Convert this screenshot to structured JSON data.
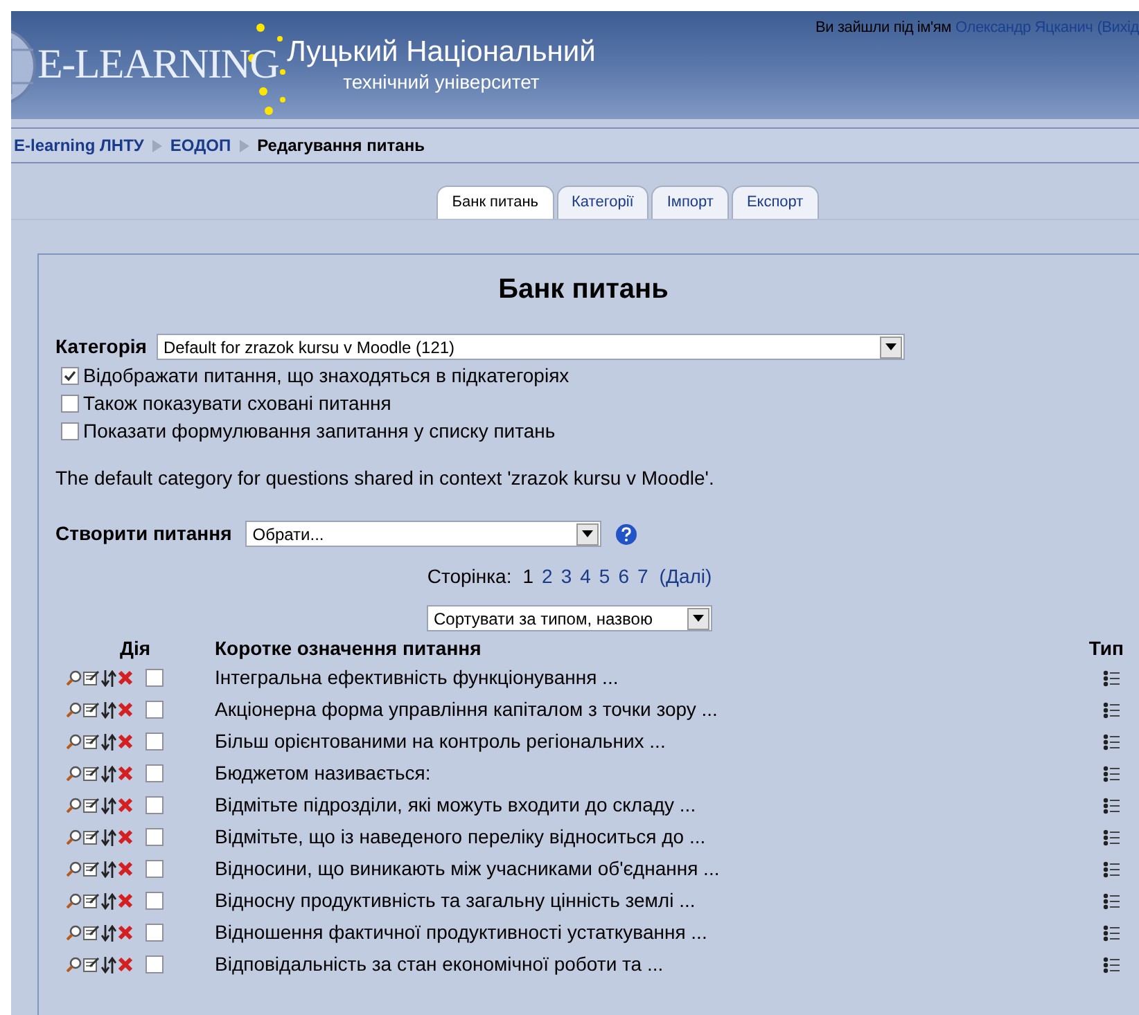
{
  "header": {
    "logo_text": "E-LEARNING",
    "institution_line1": "Луцький Національний",
    "institution_line2": "технічний університет",
    "login_prefix": "Ви зайшли під ім'ям",
    "user_link": "Олександр Яцканич",
    "logout": "(Вихід"
  },
  "breadcrumb": [
    {
      "label": "E-learning ЛНТУ",
      "kind": "link"
    },
    {
      "label": "ЕОДОП",
      "kind": "link"
    },
    {
      "label": "Редагування питань",
      "kind": "current"
    }
  ],
  "tabs": [
    {
      "label": "Банк питань",
      "selected": true
    },
    {
      "label": "Категорії",
      "selected": false
    },
    {
      "label": "Імпорт",
      "selected": false
    },
    {
      "label": "Експорт",
      "selected": false
    }
  ],
  "heading": "Банк питань",
  "category": {
    "label": "Категорія",
    "value": "Default for zrazok kursu v Moodle (121)"
  },
  "options": [
    {
      "label": "Відображати питання, що знаходяться в підкатегоріях",
      "checked": true
    },
    {
      "label": "Також показувати сховані питання",
      "checked": false
    },
    {
      "label": "Показати формулювання запитання у списку питань",
      "checked": false
    }
  ],
  "info": "The default category for questions shared in context 'zrazok kursu v Moodle'.",
  "create": {
    "label": "Створити питання",
    "value": "Обрати..."
  },
  "pagination": {
    "label": "Сторінка:",
    "pages": [
      {
        "label": "1",
        "selected": true
      },
      {
        "label": "2",
        "selected": false
      },
      {
        "label": "3",
        "selected": false
      },
      {
        "label": "4",
        "selected": false
      },
      {
        "label": "5",
        "selected": false
      },
      {
        "label": "6",
        "selected": false
      },
      {
        "label": "7",
        "selected": false
      }
    ],
    "next": "(Далі)"
  },
  "sort": {
    "value": "Сортувати за типом, назвою"
  },
  "table": {
    "columns": [
      "Дія",
      "Коротке означення питання",
      "Тип"
    ],
    "rows": [
      {
        "text": "Інтегральна ефективність функціонування ...",
        "checked": false
      },
      {
        "text": "Акціонерна форма управління капіталом з точки зору ...",
        "checked": false
      },
      {
        "text": "Більш орієнтованими на контроль регіональних ...",
        "checked": false
      },
      {
        "text": "Бюджетом називається:",
        "checked": false
      },
      {
        "text": "Відмітьте підрозділи, які можуть входити до складу ...",
        "checked": false
      },
      {
        "text": "Відмітьте, що із наведеного переліку відноситься до ...",
        "checked": false
      },
      {
        "text": "Відносини, що виникають між учасниками об'єднання ...",
        "checked": false
      },
      {
        "text": "Відносну продуктивність та загальну цінність землі ...",
        "checked": false
      },
      {
        "text": "Відношення фактичної продуктивності устаткування ...",
        "checked": false
      },
      {
        "text": "Відповідальність за стан економічної роботи та ...",
        "checked": false
      }
    ]
  }
}
